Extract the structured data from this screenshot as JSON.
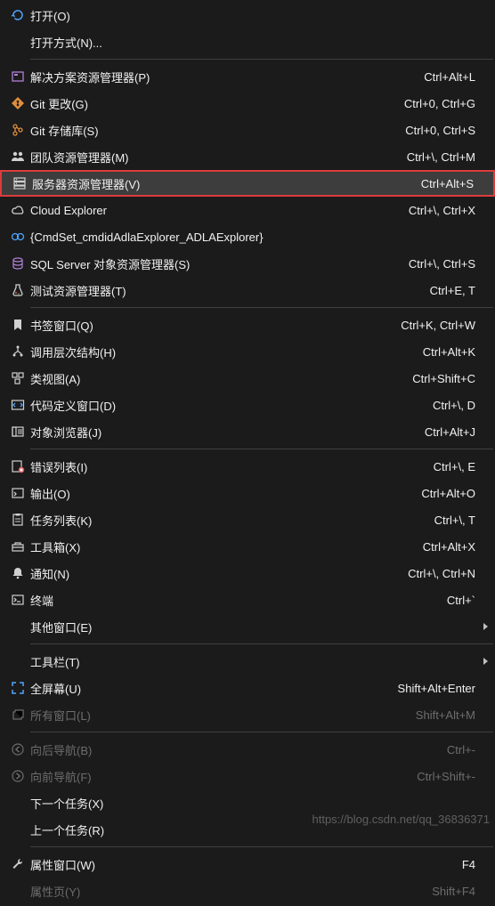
{
  "watermark": "https://blog.csdn.net/qq_36836371",
  "menu": [
    {
      "type": "item",
      "icon": "refresh",
      "label": "打开(O)"
    },
    {
      "type": "item",
      "icon": "",
      "label": "打开方式(N)..."
    },
    {
      "type": "sep"
    },
    {
      "type": "item",
      "icon": "solution",
      "label": "解决方案资源管理器(P)",
      "shortcut": "Ctrl+Alt+L"
    },
    {
      "type": "item",
      "icon": "git",
      "label": "Git 更改(G)",
      "shortcut": "Ctrl+0, Ctrl+G"
    },
    {
      "type": "item",
      "icon": "gitrepo",
      "label": "Git 存储库(S)",
      "shortcut": "Ctrl+0, Ctrl+S"
    },
    {
      "type": "item",
      "icon": "team",
      "label": "团队资源管理器(M)",
      "shortcut": "Ctrl+\\, Ctrl+M"
    },
    {
      "type": "item",
      "icon": "server",
      "label": "服务器资源管理器(V)",
      "shortcut": "Ctrl+Alt+S",
      "hovered": true,
      "highlight": true
    },
    {
      "type": "item",
      "icon": "cloud",
      "label": "Cloud Explorer",
      "shortcut": "Ctrl+\\, Ctrl+X"
    },
    {
      "type": "item",
      "icon": "adla",
      "label": "{CmdSet_cmdidAdlaExplorer_ADLAExplorer}"
    },
    {
      "type": "item",
      "icon": "sql",
      "label": "SQL Server 对象资源管理器(S)",
      "shortcut": "Ctrl+\\, Ctrl+S"
    },
    {
      "type": "item",
      "icon": "test",
      "label": "测试资源管理器(T)",
      "shortcut": "Ctrl+E, T"
    },
    {
      "type": "sep"
    },
    {
      "type": "item",
      "icon": "bookmark",
      "label": "书签窗口(Q)",
      "shortcut": "Ctrl+K, Ctrl+W"
    },
    {
      "type": "item",
      "icon": "hierarchy",
      "label": "调用层次结构(H)",
      "shortcut": "Ctrl+Alt+K"
    },
    {
      "type": "item",
      "icon": "classview",
      "label": "类视图(A)",
      "shortcut": "Ctrl+Shift+C"
    },
    {
      "type": "item",
      "icon": "codedef",
      "label": "代码定义窗口(D)",
      "shortcut": "Ctrl+\\, D"
    },
    {
      "type": "item",
      "icon": "objbrowser",
      "label": "对象浏览器(J)",
      "shortcut": "Ctrl+Alt+J"
    },
    {
      "type": "sep"
    },
    {
      "type": "item",
      "icon": "errorlist",
      "label": "错误列表(I)",
      "shortcut": "Ctrl+\\, E"
    },
    {
      "type": "item",
      "icon": "output",
      "label": "输出(O)",
      "shortcut": "Ctrl+Alt+O"
    },
    {
      "type": "item",
      "icon": "tasklist",
      "label": "任务列表(K)",
      "shortcut": "Ctrl+\\, T"
    },
    {
      "type": "item",
      "icon": "toolbox",
      "label": "工具箱(X)",
      "shortcut": "Ctrl+Alt+X"
    },
    {
      "type": "item",
      "icon": "notify",
      "label": "通知(N)",
      "shortcut": "Ctrl+\\, Ctrl+N"
    },
    {
      "type": "item",
      "icon": "terminal",
      "label": "终端",
      "shortcut": "Ctrl+`"
    },
    {
      "type": "item",
      "icon": "",
      "label": "其他窗口(E)",
      "submenu": true
    },
    {
      "type": "sep"
    },
    {
      "type": "item",
      "icon": "",
      "label": "工具栏(T)",
      "submenu": true
    },
    {
      "type": "item",
      "icon": "fullscreen",
      "label": "全屏幕(U)",
      "shortcut": "Shift+Alt+Enter"
    },
    {
      "type": "item",
      "icon": "allwindows",
      "label": "所有窗口(L)",
      "shortcut": "Shift+Alt+M",
      "disabled": true
    },
    {
      "type": "sep"
    },
    {
      "type": "item",
      "icon": "navback",
      "label": "向后导航(B)",
      "shortcut": "Ctrl+-",
      "disabled": true
    },
    {
      "type": "item",
      "icon": "navfwd",
      "label": "向前导航(F)",
      "shortcut": "Ctrl+Shift+-",
      "disabled": true
    },
    {
      "type": "item",
      "icon": "",
      "label": "下一个任务(X)"
    },
    {
      "type": "item",
      "icon": "",
      "label": "上一个任务(R)"
    },
    {
      "type": "sep"
    },
    {
      "type": "item",
      "icon": "properties",
      "label": "属性窗口(W)",
      "shortcut": "F4"
    },
    {
      "type": "item",
      "icon": "",
      "label": "属性页(Y)",
      "shortcut": "Shift+F4",
      "disabled": true
    }
  ]
}
